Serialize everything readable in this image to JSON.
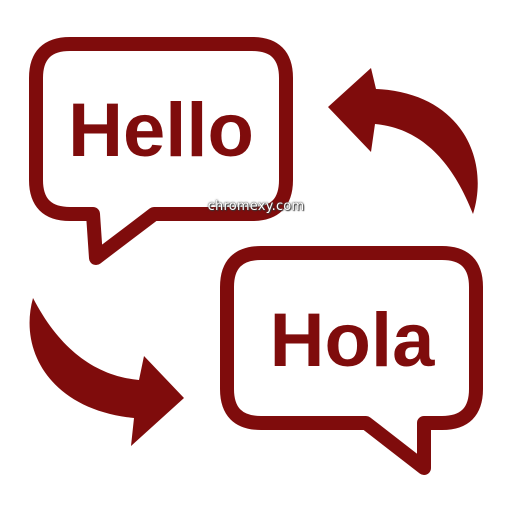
{
  "colors": {
    "primary": "#7f0c0c",
    "background": "#ffffff"
  },
  "bubble_top": {
    "text": "Hello"
  },
  "bubble_bottom": {
    "text": "Hola"
  },
  "arrows": {
    "top_right": "curved-arrow-left-icon",
    "bottom_left": "curved-arrow-right-icon"
  },
  "watermark": {
    "text": "chromexy.com"
  }
}
